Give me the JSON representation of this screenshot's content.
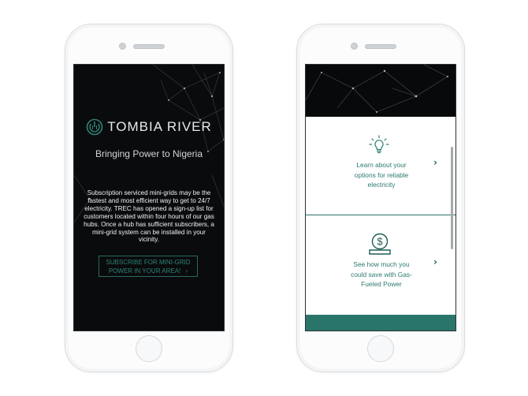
{
  "left_screen": {
    "brand": "TOMBIA RIVER",
    "tagline": "Bringing Power to Nigeria",
    "body_lines": [
      "Subscription serviced mini-grids may be the",
      "fastest and most efficient way to get to 24/7",
      "electricity. TREC has opened a sign-up list for",
      "customers located within four hours of our gas",
      "hubs. Once a hub has sufficient subscribers, a",
      "mini-grid system can be installed in your",
      "vicinity."
    ],
    "cta_line1": "SUBSCRIBE FOR MINI-GRID",
    "cta_line2": "POWER IN YOUR AREA!",
    "cta_chevron": "›"
  },
  "right_screen": {
    "cards": [
      {
        "icon": "lightbulb-icon",
        "lines": [
          "Learn about your",
          "options for reliable",
          "electricity"
        ],
        "chevron": "›"
      },
      {
        "icon": "savings-icon",
        "lines": [
          "See how much you",
          "could save with Gas-",
          "Fueled Power"
        ],
        "chevron": "›"
      }
    ]
  },
  "colors": {
    "accent": "#2b7a70",
    "footer": "#2a7569",
    "screen_bg": "#0a0b0c"
  }
}
